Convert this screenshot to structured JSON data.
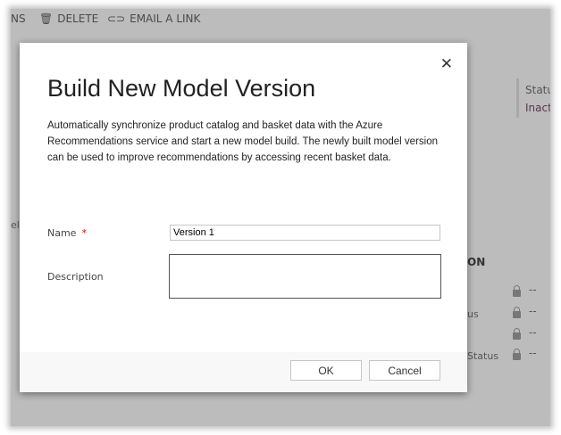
{
  "toolbar": {
    "partial": "NS",
    "delete": "DELETE",
    "email": "EMAIL A LINK"
  },
  "background": {
    "status_label": "Statu",
    "status_value": "Inact",
    "section": "ON",
    "left_frag": "el",
    "rows": [
      {
        "label": "",
        "value": "--"
      },
      {
        "label": "us",
        "value": "--"
      },
      {
        "label": "",
        "value": "--"
      },
      {
        "label": "Status",
        "value": "--"
      }
    ]
  },
  "dialog": {
    "title": "Build New Model Version",
    "description": "Automatically synchronize product catalog and basket data with the Azure Recommendations service and start a new model build. The newly built model version can be used to improve recommendations by accessing recent basket data.",
    "name_label": "Name",
    "required_mark": "*",
    "name_value": "Version 1",
    "description_label": "Description",
    "description_value": "",
    "ok": "OK",
    "cancel": "Cancel",
    "close": "✕"
  }
}
